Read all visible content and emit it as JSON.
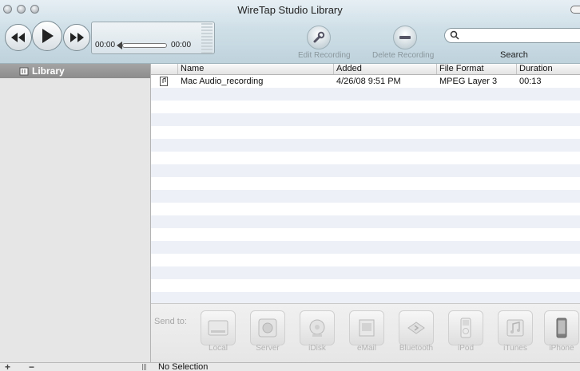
{
  "window": {
    "title": "WireTap Studio Library"
  },
  "transport": {
    "time_elapsed": "00:00",
    "time_remaining": "00:00"
  },
  "toolbar": {
    "edit_label": "Edit Recording",
    "delete_label": "Delete Recording",
    "search_label": "Search",
    "search_value": ""
  },
  "sidebar": {
    "items": [
      {
        "label": "Library",
        "icon": "library-icon"
      }
    ]
  },
  "table": {
    "columns": [
      "Name",
      "Added",
      "File Format",
      "Duration"
    ],
    "rows": [
      {
        "name": "Mac Audio_recording",
        "added": "4/26/08 9:51 PM",
        "format": "MPEG Layer 3",
        "duration": "00:13"
      }
    ]
  },
  "sendto": {
    "label": "Send to:",
    "destinations": [
      {
        "label": "Local",
        "icon": "hard-drive-icon"
      },
      {
        "label": "Server",
        "icon": "server-icon"
      },
      {
        "label": "iDisk",
        "icon": "idisk-icon"
      },
      {
        "label": "eMail",
        "icon": "email-icon"
      },
      {
        "label": "Bluetooth",
        "icon": "bluetooth-icon"
      },
      {
        "label": "iPod",
        "icon": "ipod-icon"
      },
      {
        "label": "iTunes",
        "icon": "itunes-icon"
      },
      {
        "label": "iPhone",
        "icon": "iphone-icon"
      }
    ]
  },
  "bottom": {
    "add": "+",
    "remove": "−",
    "status": "No Selection"
  }
}
